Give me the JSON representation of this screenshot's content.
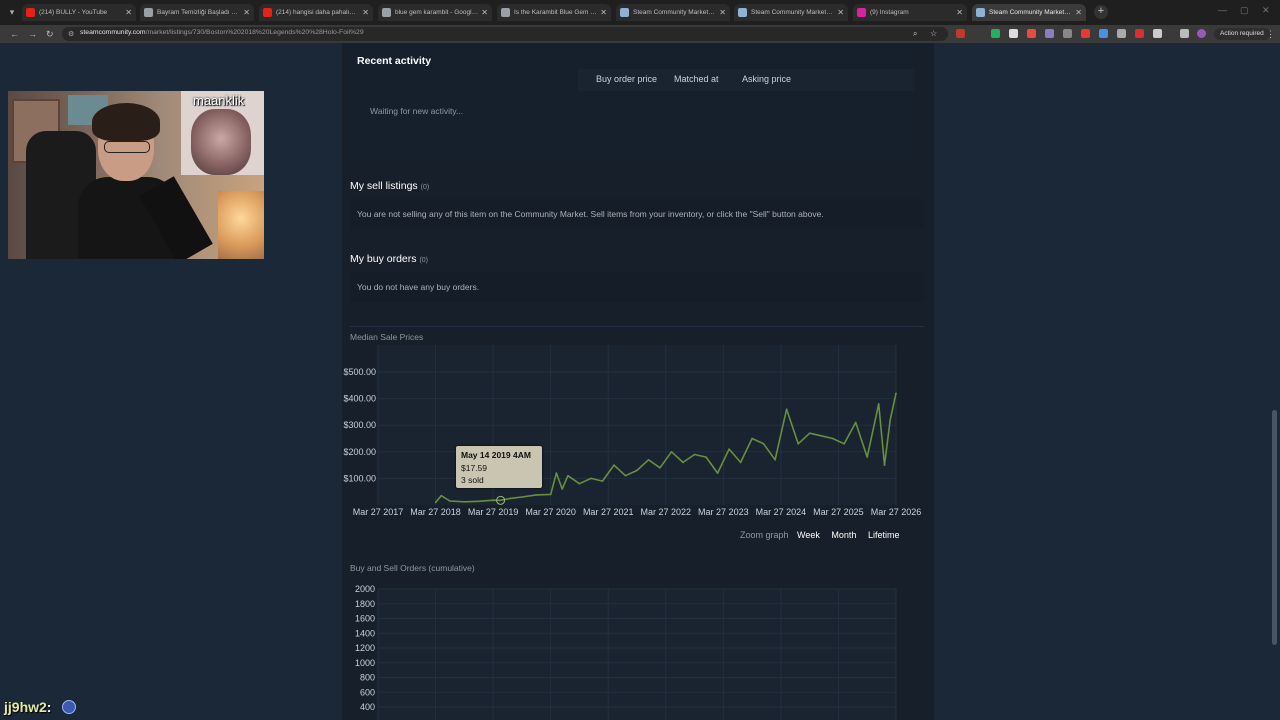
{
  "browser": {
    "tabs": [
      {
        "title": "(214) BULLY - YouTube",
        "favicon_color": "#e62117"
      },
      {
        "title": "Bayram Temizliği Başladı Hazır...",
        "favicon_color": "#9aa0a6"
      },
      {
        "title": "(214) hangisi daha pahalı? #cs...",
        "favicon_color": "#e62117"
      },
      {
        "title": "blue gem karambit - Google S...",
        "favicon_color": "#9aa0a6"
      },
      {
        "title": "Is the Karambit Blue Gem Wort...",
        "favicon_color": "#9aa0a6"
      },
      {
        "title": "Steam Community Market :: Lis...",
        "favicon_color": "#8fb2d4"
      },
      {
        "title": "Steam Community Market :: Lis...",
        "favicon_color": "#8fb2d4"
      },
      {
        "title": "(9) Instagram",
        "favicon_color": "#d6249f"
      },
      {
        "title": "Steam Community Market :: Lis...",
        "favicon_color": "#8fb2d4"
      }
    ],
    "url_host": "steamcommunity.com",
    "url_path": "/market/listings/730/Boston%202018%20Legends%20%28Holo-Foil%29",
    "action_required": "Action required"
  },
  "recent_activity": {
    "title": "Recent activity",
    "col_buy": "Buy order price",
    "col_matched": "Matched at",
    "col_ask": "Asking price",
    "waiting": "Waiting for new activity..."
  },
  "sell_listings": {
    "title": "My sell listings",
    "count": "(0)",
    "message": "You are not selling any of this item on the Community Market. Sell items from your inventory, or click the \"Sell\" button above."
  },
  "buy_orders": {
    "title": "My buy orders",
    "count": "(0)",
    "message": "You do not have any buy orders."
  },
  "price_chart": {
    "label": "Median Sale Prices",
    "tooltip_date": "May 14 2019 4AM",
    "tooltip_price": "$17.59",
    "tooltip_sold": "3 sold"
  },
  "zoom": {
    "label": "Zoom graph",
    "week": "Week",
    "month": "Month",
    "lifetime": "Lifetime"
  },
  "orders_chart": {
    "label": "Buy and Sell Orders (cumulative)"
  },
  "overlay": {
    "streamer_name": "maanklik",
    "chat_user": "jj9hw2",
    "chat_colon": ":"
  },
  "chart_data": [
    {
      "type": "line",
      "title": "Median Sale Prices",
      "xlabel": "",
      "ylabel": "",
      "x_ticks": [
        "Mar 27 2017",
        "Mar 27 2018",
        "Mar 27 2019",
        "Mar 27 2020",
        "Mar 27 2021",
        "Mar 27 2022",
        "Mar 27 2023",
        "Mar 27 2024",
        "Mar 27 2025",
        "Mar 27 2026"
      ],
      "y_ticks": [
        "$100.00",
        "$200.00",
        "$300.00",
        "$400.00",
        "$500.00"
      ],
      "ylim": [
        0,
        500
      ],
      "series": [
        {
          "color": "#688f3e",
          "x": [
            2018.0,
            2018.1,
            2018.25,
            2018.5,
            2018.75,
            2019.0,
            2019.13,
            2019.3,
            2019.5,
            2019.75,
            2020.0,
            2020.1,
            2020.2,
            2020.3,
            2020.5,
            2020.7,
            2020.9,
            2021.1,
            2021.3,
            2021.5,
            2021.7,
            2021.9,
            2022.1,
            2022.3,
            2022.5,
            2022.7,
            2022.9,
            2023.1,
            2023.3,
            2023.5,
            2023.7,
            2023.9,
            2024.1,
            2024.3,
            2024.5,
            2024.7,
            2024.9,
            2025.1,
            2025.3,
            2025.5,
            2025.7,
            2025.8,
            2025.9,
            2026.0
          ],
          "y": [
            10,
            35,
            15,
            12,
            14,
            18,
            17.59,
            25,
            30,
            38,
            40,
            120,
            60,
            110,
            80,
            100,
            90,
            150,
            110,
            130,
            170,
            140,
            200,
            160,
            190,
            180,
            120,
            210,
            160,
            250,
            230,
            170,
            360,
            230,
            270,
            260,
            250,
            230,
            310,
            180,
            380,
            150,
            320,
            420
          ]
        }
      ]
    },
    {
      "type": "line",
      "title": "Buy and Sell Orders (cumulative)",
      "y_ticks": [
        "400",
        "600",
        "800",
        "1000",
        "1200",
        "1400",
        "1600",
        "1800",
        "2000"
      ],
      "ylim": [
        400,
        2000
      ],
      "series": []
    }
  ]
}
